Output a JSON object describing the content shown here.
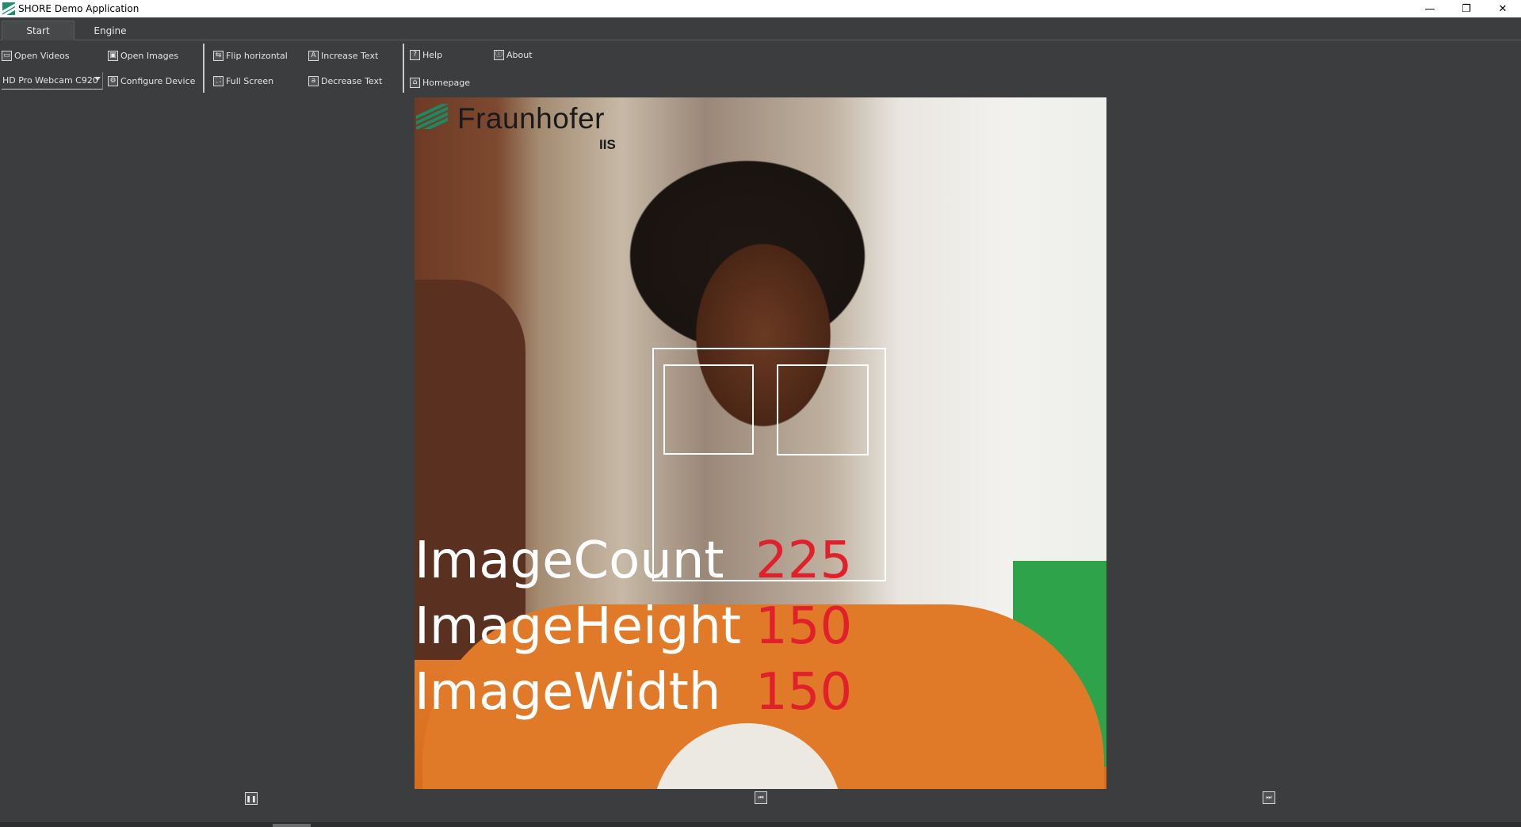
{
  "window": {
    "title": "SHORE Demo Application",
    "controls": {
      "minimize": "—",
      "restore": "❐",
      "close": "✕"
    }
  },
  "tabs": [
    {
      "label": "Start",
      "active": true
    },
    {
      "label": "Engine",
      "active": false
    }
  ],
  "ribbon": {
    "open_videos": "Open Videos",
    "device_select": "HD Pro Webcam C920",
    "open_images": "Open Images",
    "configure_device": "Configure Device",
    "flip_horizontal": "Flip horizontal",
    "full_screen": "Full Screen",
    "increase_text": "Increase Text",
    "decrease_text": "Decrease Text",
    "help": "Help",
    "homepage": "Homepage",
    "about": "About"
  },
  "logo": {
    "name": "Fraunhofer",
    "sub": "IIS"
  },
  "stats": [
    {
      "label": "ImageCount",
      "value": "225"
    },
    {
      "label": "ImageHeight",
      "value": "150"
    },
    {
      "label": "ImageWidth",
      "value": "150"
    }
  ],
  "colors": {
    "background": "#3b3d3f",
    "value": "#e0202a",
    "label": "#ffffff",
    "logo_green": "#1b8a64"
  },
  "icons": {
    "pause": "pause-icon",
    "step_back": "skip-back-icon",
    "step_forward": "skip-forward-icon"
  }
}
